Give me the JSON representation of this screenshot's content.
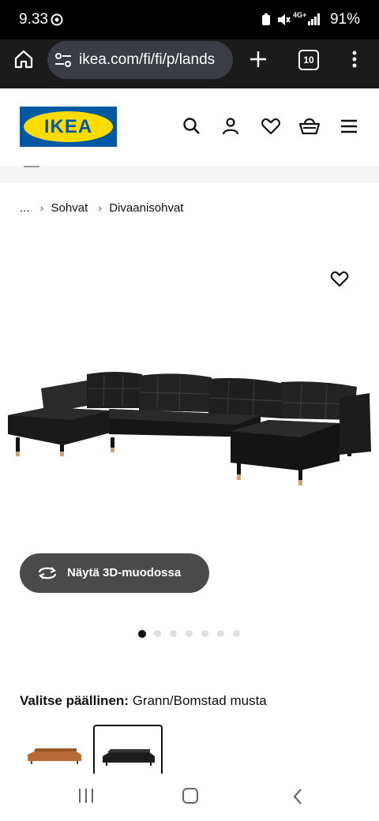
{
  "status_bar": {
    "time": "9.33",
    "network": "4G+",
    "battery": "91%"
  },
  "browser": {
    "url": "ikea.com/fi/fi/p/lands",
    "tab_count": "10"
  },
  "header": {
    "logo_text": "IKEA"
  },
  "breadcrumb": {
    "ellipsis": "...",
    "items": [
      "Sohvat",
      "Divaanisohvat"
    ]
  },
  "product": {
    "view_3d_label": "Näytä 3D-muodossa",
    "image_count": 7,
    "active_image_index": 0
  },
  "cover": {
    "label": "Valitse päällinen:",
    "value": "Grann/Bomstad musta",
    "swatches": [
      {
        "color_name": "golden-brown",
        "color": "#b86a35",
        "selected": false
      },
      {
        "color_name": "black",
        "color": "#1d1d1d",
        "selected": true
      }
    ]
  },
  "colors": {
    "ikea_blue": "#0058a3",
    "ikea_yellow": "#ffdb00",
    "button_grey": "#4a4a4a"
  }
}
